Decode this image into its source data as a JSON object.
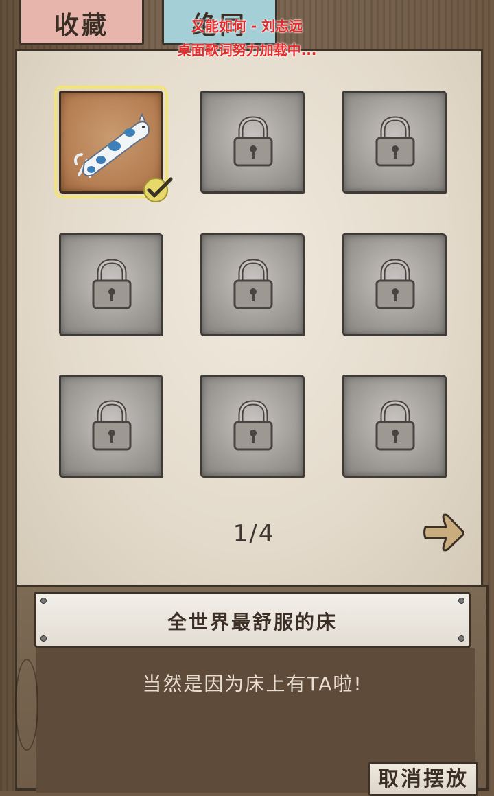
{
  "tabs": {
    "collect_label": "收藏",
    "other_label": "绝同"
  },
  "lyric_overlay": {
    "line1": "又能如何 - 刘志远",
    "line2": "桌面歌词努力加载中..."
  },
  "grid": {
    "slots": [
      {
        "state": "unlocked",
        "selected": true,
        "icon": "cat-pillow-icon"
      },
      {
        "state": "locked",
        "icon": "lock-icon"
      },
      {
        "state": "locked",
        "icon": "lock-icon"
      },
      {
        "state": "locked",
        "icon": "lock-icon"
      },
      {
        "state": "locked",
        "icon": "lock-icon"
      },
      {
        "state": "locked",
        "icon": "lock-icon"
      },
      {
        "state": "locked",
        "icon": "lock-icon"
      },
      {
        "state": "locked",
        "icon": "lock-icon"
      },
      {
        "state": "locked",
        "icon": "lock-icon"
      }
    ]
  },
  "pagination": {
    "label": "1/4",
    "next_icon": "arrow-right-icon"
  },
  "item_info": {
    "title": "全世界最舒服的床",
    "description": "当然是因为床上有TA啦!"
  },
  "actions": {
    "cancel_label": "取消摆放"
  },
  "colors": {
    "tab_collect": "#e8b5ad",
    "tab_other": "#a5cfd6",
    "lyric_red": "#e52a2a",
    "selected_outline": "#f3e477"
  }
}
